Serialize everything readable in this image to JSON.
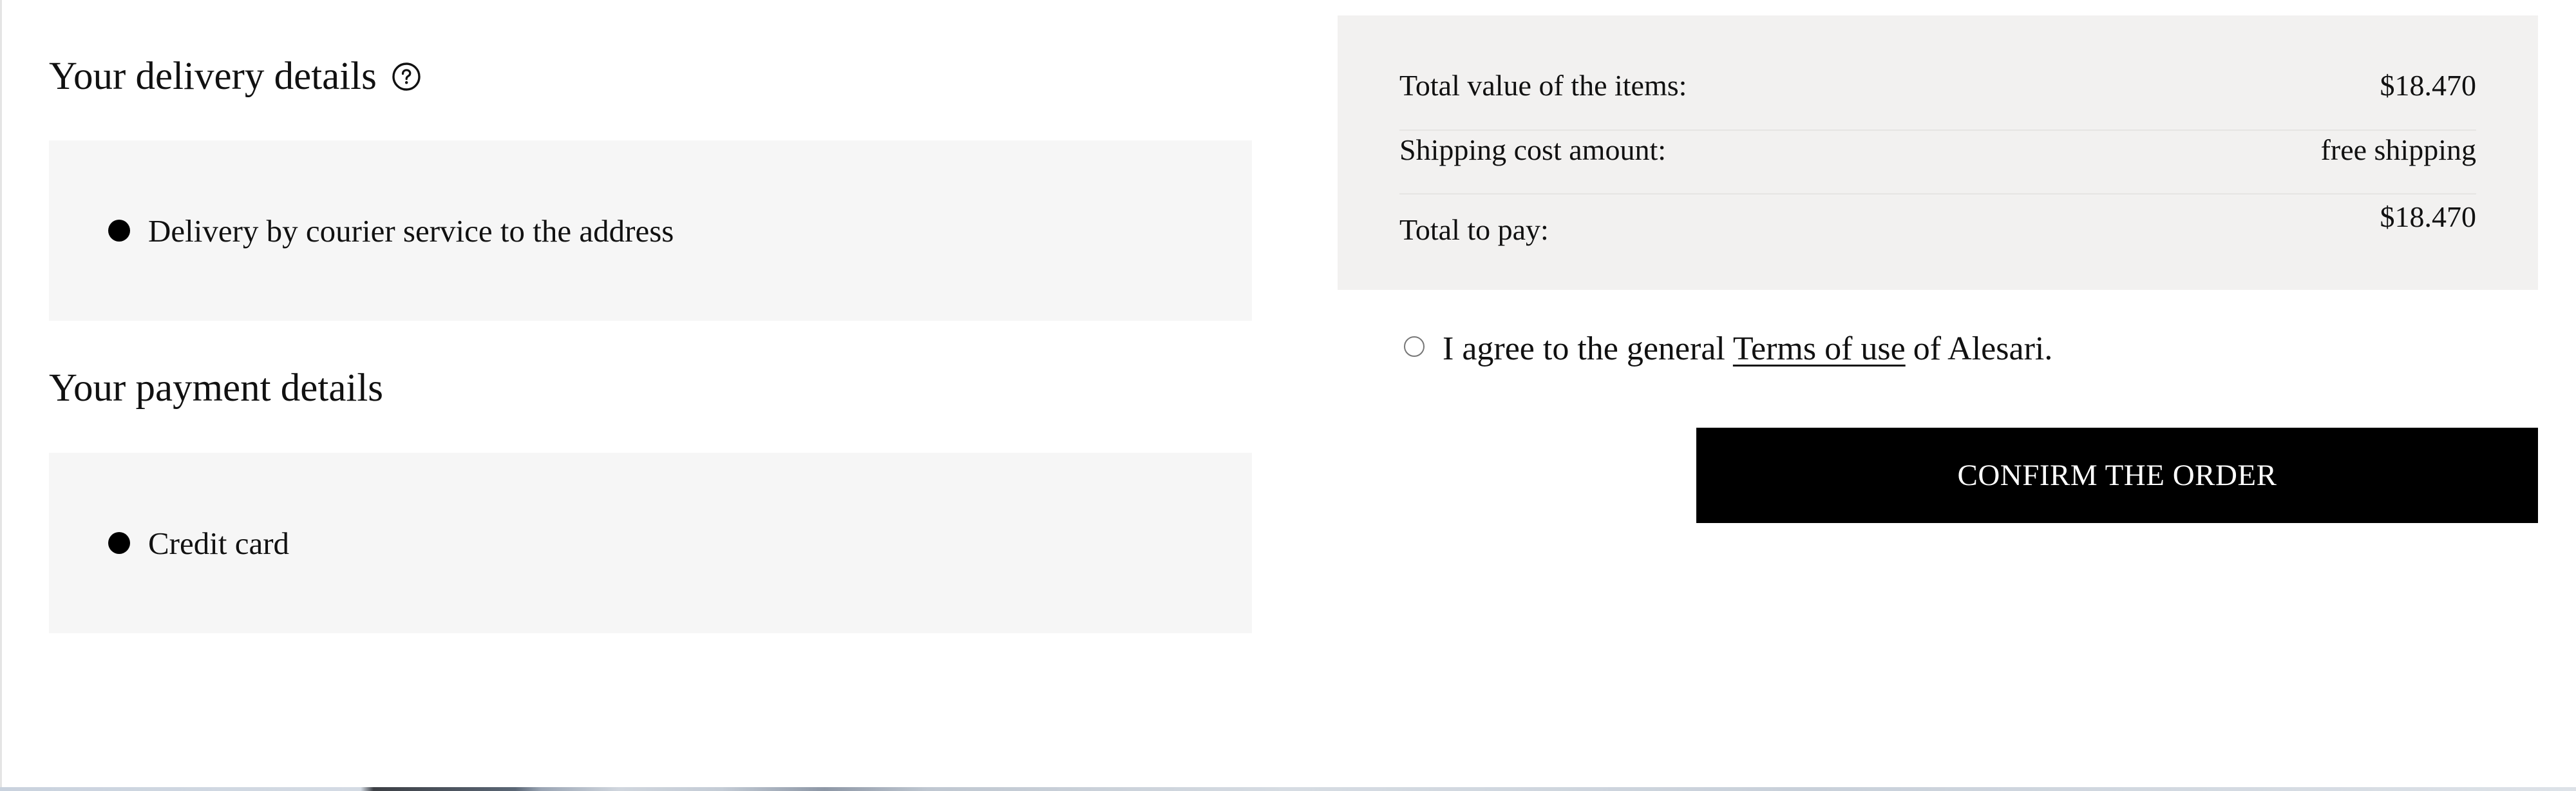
{
  "delivery": {
    "title": "Your delivery details",
    "help_icon": "question-circle-icon",
    "option_label": "Delivery by courier service to the address"
  },
  "payment": {
    "title": "Your payment details",
    "option_label": "Credit card"
  },
  "summary": {
    "items_label": "Total value of the items:",
    "items_value": "$18.470",
    "shipping_label": "Shipping cost amount:",
    "shipping_value": "free shipping",
    "total_label": "Total to pay:",
    "total_value": "$18.470"
  },
  "terms": {
    "prefix": "I agree to the general",
    "link_text": "Terms of use",
    "suffix": "of Alesari."
  },
  "confirm_button": {
    "label": "CONFIRM THE ORDER"
  },
  "colors": {
    "option_box_bg": "#f6f6f6",
    "summary_bg": "#f2f1f0",
    "button_bg": "#000000",
    "button_text": "#ffffff"
  }
}
